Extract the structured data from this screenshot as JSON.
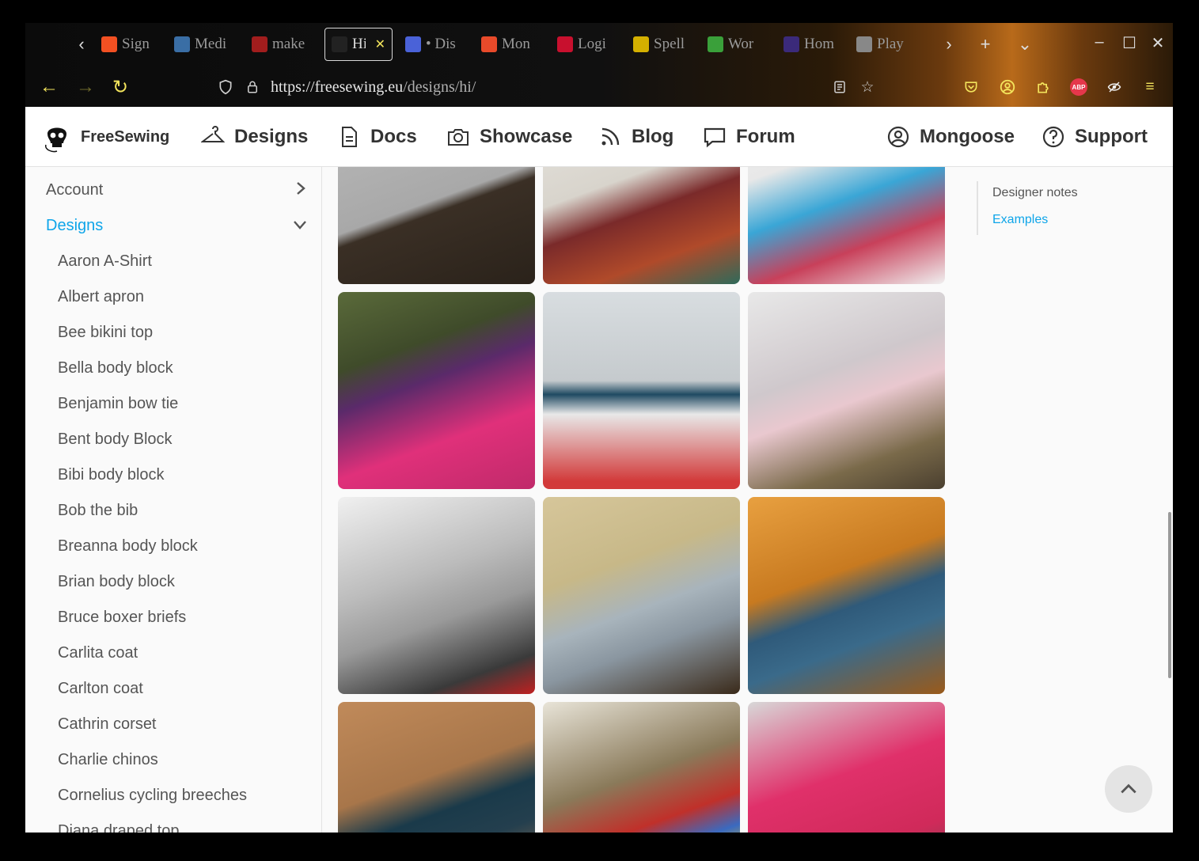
{
  "browser": {
    "tabs": [
      {
        "label": "Sign",
        "icon": "microsoft-icon",
        "color": "#f25022"
      },
      {
        "label": "Medi",
        "icon": "martini-icon",
        "color": "#3a6ea5"
      },
      {
        "label": "make",
        "icon": "book-icon",
        "color": "#a11d1d"
      },
      {
        "label": "Hi",
        "icon": "freesewing-skull-icon",
        "color": "#222222",
        "active": true
      },
      {
        "label": "• Dis",
        "icon": "discord-icon",
        "color": "#4a62d8"
      },
      {
        "label": "Mon",
        "icon": "f-icon",
        "color": "#e84a2a"
      },
      {
        "label": "Logi",
        "icon": "flag-icon",
        "color": "#c8102e"
      },
      {
        "label": "Spell",
        "icon": "bee-icon",
        "color": "#d4b000"
      },
      {
        "label": "Wor",
        "icon": "w-icon",
        "color": "#3aa03a"
      },
      {
        "label": "Hom",
        "icon": "io-icon",
        "color": "#3b2a7a"
      },
      {
        "label": "Play",
        "icon": "grid-icon",
        "color": "#888888"
      }
    ],
    "url_host": "https://freesewing.eu",
    "url_path": "/designs/hi/",
    "abp_label": "ABP"
  },
  "header": {
    "brand": "FreeSewing",
    "nav": [
      "Designs",
      "Docs",
      "Showcase",
      "Blog",
      "Forum"
    ],
    "user": "Mongoose",
    "support": "Support"
  },
  "sidebar": {
    "top": [
      {
        "label": "Account"
      },
      {
        "label": "Designs",
        "active": true
      }
    ],
    "designs": [
      "Aaron A-Shirt",
      "Albert apron",
      "Bee bikini top",
      "Bella body block",
      "Benjamin bow tie",
      "Bent body Block",
      "Bibi body block",
      "Bob the bib",
      "Breanna body block",
      "Brian body block",
      "Bruce boxer briefs",
      "Carlita coat",
      "Carlton coat",
      "Cathrin corset",
      "Charlie chinos",
      "Cornelius cycling breeches",
      "Diana draped top"
    ]
  },
  "toc": {
    "items": [
      "Designer notes",
      "Examples"
    ]
  },
  "colors": {
    "accent": "#0ea5e9",
    "browser_icons": "#f3e45c"
  }
}
